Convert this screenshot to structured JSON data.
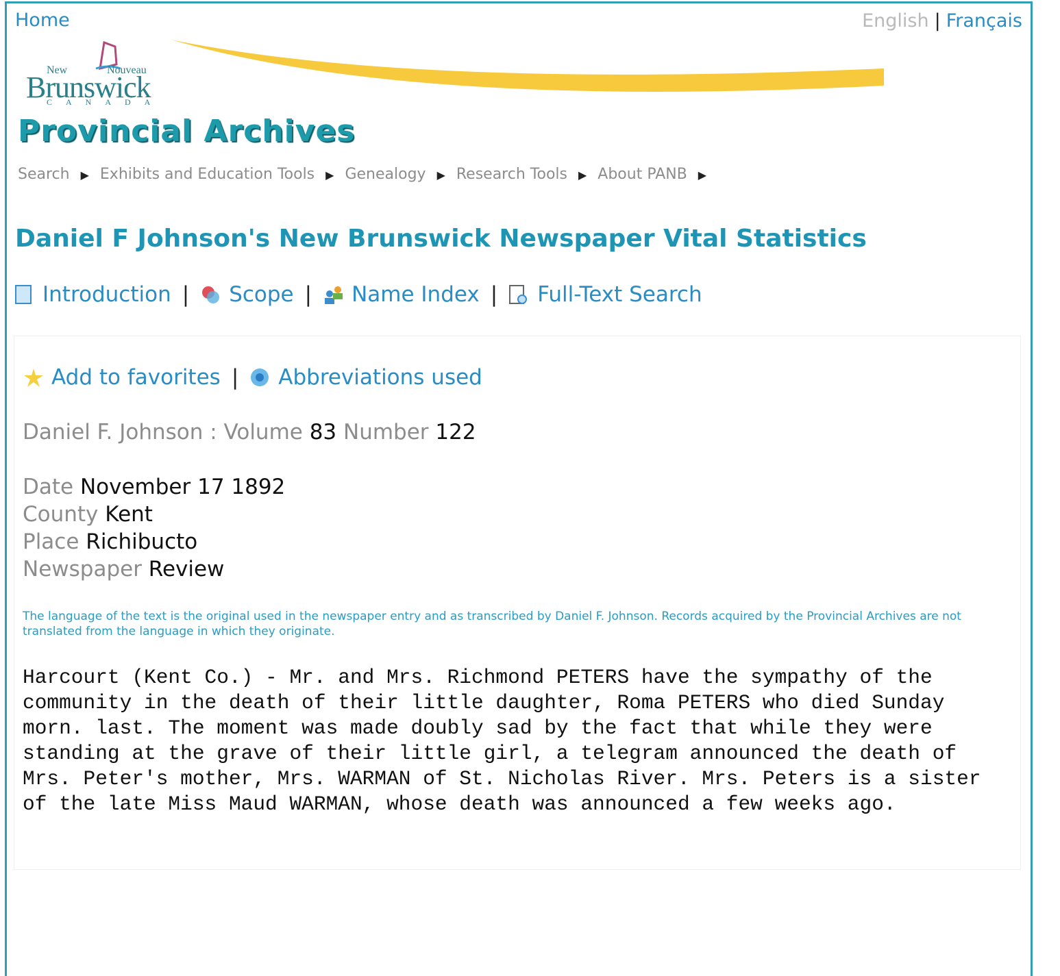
{
  "header": {
    "home": "Home",
    "lang_en": "English",
    "lang_sep": "|",
    "lang_fr": "Français",
    "logo": {
      "new": "New",
      "nouveau": "Nouveau",
      "brunswick": "Brunswick",
      "canada": "CANADA"
    },
    "site_title": "Provincial Archives"
  },
  "nav": [
    "Search",
    "Exhibits and Education Tools",
    "Genealogy",
    "Research Tools",
    "About PANB"
  ],
  "page_title": "Daniel F Johnson's New Brunswick Newspaper Vital Statistics",
  "tabs": [
    {
      "label": "Introduction",
      "icon": "document-icon"
    },
    {
      "label": "Scope",
      "icon": "scope-icon"
    },
    {
      "label": "Name Index",
      "icon": "people-icon"
    },
    {
      "label": "Full-Text Search",
      "icon": "search-document-icon"
    }
  ],
  "sep": "|",
  "actions": {
    "favorites": "Add to favorites",
    "abbrev": "Abbreviations used"
  },
  "record": {
    "source_label": "Daniel F. Johnson : Volume",
    "volume": "83",
    "number_label": "Number",
    "number": "122",
    "date_label": "Date",
    "date": "November 17 1892",
    "county_label": "County",
    "county": "Kent",
    "place_label": "Place",
    "place": "Richibucto",
    "newspaper_label": "Newspaper",
    "newspaper": "Review"
  },
  "note": "The language of the text is the original used in the newspaper entry and as transcribed by Daniel F. Johnson. Records acquired by the Provincial Archives are not translated from the language in which they originate.",
  "text": "Harcourt (Kent Co.) - Mr. and Mrs. Richmond PETERS have the sympathy of the community in the death of their little daughter, Roma PETERS who died Sunday morn. last. The moment was made doubly sad by the fact that while they were standing at the grave of their little girl, a telegram announced the death of Mrs. Peter's mother, Mrs. WARMAN of St. Nicholas River. Mrs. Peters is a sister of the late Miss Maud WARMAN, whose death was announced a few weeks ago."
}
